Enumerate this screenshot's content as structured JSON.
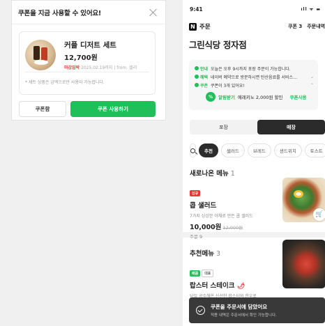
{
  "modal": {
    "title": "쿠폰을 지금 사용할 수 있어요!",
    "coupon": {
      "name": "커플 디저트 세트",
      "price": "12,700원",
      "deadline_label": "마감임박",
      "expiry": "2025.02.19까지",
      "from": "from. 셀리"
    },
    "note": "* 세트 상품은 금액으로만 사용이 가능합니다.",
    "coupon_box_button": "쿠폰함",
    "use_button": "쿠폰 사용하기"
  },
  "phone": {
    "status_time": "9:41",
    "status_icons": "ıll ᯤ ▬",
    "brand": "주문",
    "coupon_count_link": "쿠폰 3",
    "order_history_link": "주문내역",
    "store_name": "그린식당 정자점",
    "info": [
      {
        "tag": "안내",
        "text": "오늘은 오후 9시까지 포장 주문이 가능합니다."
      },
      {
        "tag": "혜택",
        "text": "네이버 예약으로 방문하시면 탄산음료를 서비스…"
      },
      {
        "tag": "쿠폰",
        "text": "쿠폰이 3개 있어요!"
      }
    ],
    "coupon_line": {
      "badge": "%",
      "highlight": "알림받기",
      "text": "에레키노 2,000원 할인",
      "action": "쿠폰사용"
    },
    "segments": {
      "takeout": "포장",
      "dine_in": "매장"
    },
    "chips": [
      "추천",
      "샐러드",
      "브레드",
      "샌드위치",
      "토스트"
    ],
    "sections": [
      {
        "title": "새로나온 메뉴",
        "count": "1",
        "item": {
          "badges": [
            "신규"
          ],
          "name": "콥 샐러드",
          "desc": "7가지 싱싱한 야채로 만든 콥 샐러드",
          "price": "10,000원",
          "orig_price": "12,000원",
          "qty": "주문 9"
        }
      },
      {
        "title": "추천메뉴",
        "count": "3",
        "item": {
          "badges": [
            "매콤",
            "대표"
          ],
          "name": "랍스터 스테이크",
          "desc": "당일 공수해온 신선한 랍스터와 한우로"
        }
      }
    ],
    "toast": {
      "title": "쿠폰을 주문서에 담았어요",
      "sub": "적용 내역은 주문서에서 확인 가능합니다."
    }
  }
}
